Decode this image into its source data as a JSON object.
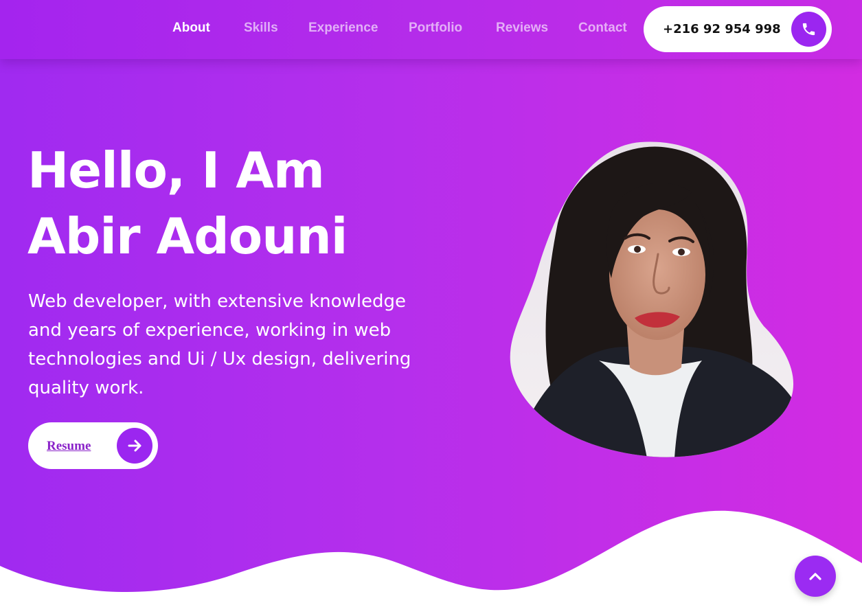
{
  "nav": {
    "items": [
      {
        "label": "About",
        "active": true
      },
      {
        "label": "Skills",
        "active": false
      },
      {
        "label": "Experience",
        "active": false
      },
      {
        "label": "Portfolio",
        "active": false
      },
      {
        "label": "Reviews",
        "active": false
      },
      {
        "label": "Contact",
        "active": false
      }
    ]
  },
  "contact": {
    "phone": "+216 92 954 998",
    "icon": "phone-icon"
  },
  "hero": {
    "title_line1": "Hello, I Am",
    "title_line2": "Abir Adouni",
    "description": "Web developer, with extensive knowledge and years of experience, working in web technologies and Ui / Ux design, delivering quality work.",
    "resume_label": "Resume",
    "resume_icon": "arrow-right-icon"
  },
  "scroll_top": {
    "icon": "chevron-up-icon"
  },
  "colors": {
    "accent": "#9b26f0",
    "gradient_start": "#a02af0",
    "gradient_end": "#d22ce2",
    "white": "#ffffff"
  }
}
